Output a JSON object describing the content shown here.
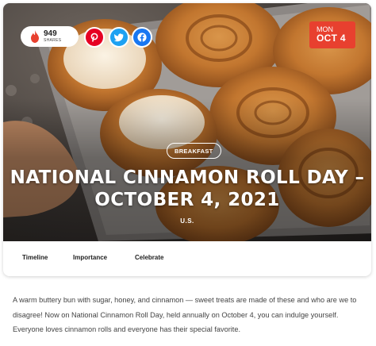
{
  "share": {
    "count": "949",
    "label": "SHARES"
  },
  "social": {
    "pinterest_icon": "pinterest-icon",
    "twitter_icon": "twitter-icon",
    "facebook_icon": "facebook-icon"
  },
  "date": {
    "day_of_week": "MON",
    "day_month": "OCT 4"
  },
  "hero": {
    "category": "BREAKFAST",
    "title": "NATIONAL CINNAMON ROLL DAY – OCTOBER 4, 2021",
    "region": "U.S."
  },
  "tabs": [
    "Timeline",
    "Importance",
    "Celebrate"
  ],
  "intro": "A warm buttery bun with sugar, honey, and cinnamon — sweet treats are made of these and who are we to disagree! Now on National Cinnamon Roll Day, held annually on October 4, you can indulge yourself. Everyone loves cinnamon rolls and everyone has their special favorite.",
  "colors": {
    "accent_red": "#e8402f",
    "pinterest": "#e60023",
    "twitter": "#1da1f2",
    "facebook": "#1877f2"
  }
}
